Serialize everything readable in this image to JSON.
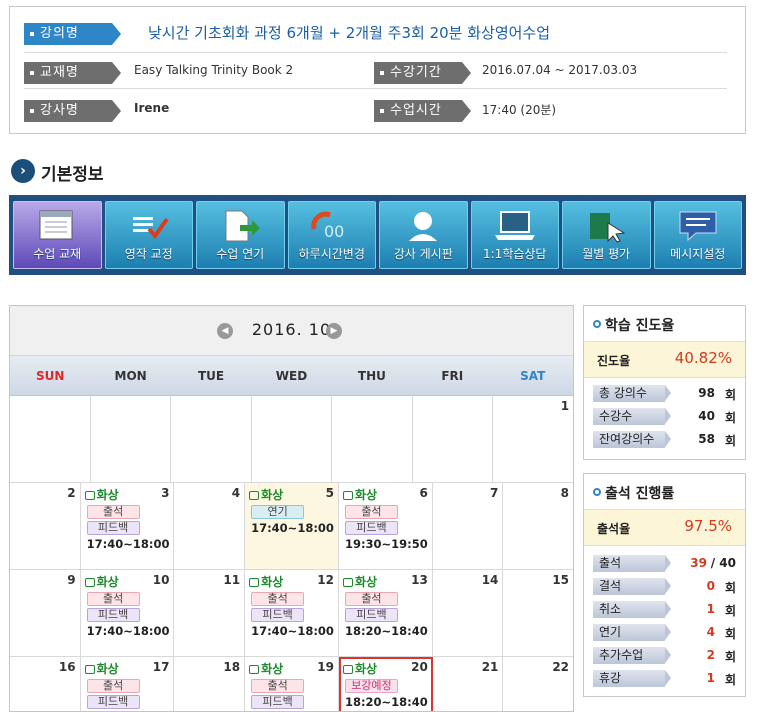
{
  "course": {
    "name_label": "강의명",
    "name": "낮시간 기초회화 과정 6개월 + 2개월 주3회 20분 화상영어수업",
    "book_label": "교재명",
    "book": "Easy Talking Trinity Book 2",
    "period_label": "수강기간",
    "period": "2016.07.04 ~ 2017.03.03",
    "teacher_label": "강사명",
    "teacher": "Irene",
    "time_label": "수업시간",
    "time": "17:40 (20분)"
  },
  "section": {
    "title": "기본정보"
  },
  "toolbar": [
    {
      "label": "수업 교재",
      "icon": "book-icon"
    },
    {
      "label": "영작 교정",
      "icon": "checkmark-edit-icon"
    },
    {
      "label": "수업 연기",
      "icon": "document-arrow-icon"
    },
    {
      "label": "하루시간변경",
      "icon": "clock-change-icon"
    },
    {
      "label": "강사 게시판",
      "icon": "user-icon"
    },
    {
      "label": "1:1학습상담",
      "icon": "laptop-icon"
    },
    {
      "label": "월별 평가",
      "icon": "chart-cursor-icon"
    },
    {
      "label": "메시지설정",
      "icon": "chat-bubble-icon"
    }
  ],
  "calendar": {
    "month": "2016. 10",
    "days": [
      "SUN",
      "MON",
      "TUE",
      "WED",
      "THU",
      "FRI",
      "SAT"
    ],
    "sun_color": "#e02828",
    "sat_color": "#2f86c6",
    "lesson_label": "화상",
    "attend_label": "출석",
    "feedback_label": "피드백",
    "delay_label": "연기",
    "makeup_label": "보강예정",
    "weeks": [
      [
        {
          "n": ""
        },
        {
          "n": ""
        },
        {
          "n": ""
        },
        {
          "n": ""
        },
        {
          "n": ""
        },
        {
          "n": ""
        },
        {
          "n": "1"
        }
      ],
      [
        {
          "n": "2"
        },
        {
          "n": "3",
          "lesson": true,
          "tags": [
            "att",
            "fb"
          ],
          "time": "17:40~18:00"
        },
        {
          "n": "4"
        },
        {
          "n": "5",
          "lesson": true,
          "today": true,
          "tags": [
            "del"
          ],
          "time": "17:40~18:00"
        },
        {
          "n": "6",
          "lesson": true,
          "tags": [
            "att",
            "fb"
          ],
          "time": "19:30~19:50"
        },
        {
          "n": "7"
        },
        {
          "n": "8"
        }
      ],
      [
        {
          "n": "9"
        },
        {
          "n": "10",
          "lesson": true,
          "tags": [
            "att",
            "fb"
          ],
          "time": "17:40~18:00"
        },
        {
          "n": "11"
        },
        {
          "n": "12",
          "lesson": true,
          "tags": [
            "att",
            "fb"
          ],
          "time": "17:40~18:00"
        },
        {
          "n": "13",
          "lesson": true,
          "tags": [
            "att",
            "fb"
          ],
          "time": "18:20~18:40"
        },
        {
          "n": "14"
        },
        {
          "n": "15"
        }
      ],
      [
        {
          "n": "16"
        },
        {
          "n": "17",
          "lesson": true,
          "tags": [
            "att",
            "fb"
          ],
          "time": "17:40~18:00"
        },
        {
          "n": "18"
        },
        {
          "n": "19",
          "lesson": true,
          "tags": [
            "att",
            "fb"
          ],
          "time": "17:40~18:00"
        },
        {
          "n": "20",
          "lesson": true,
          "selected": true,
          "tags": [
            "mk"
          ],
          "time": "18:20~18:40"
        },
        {
          "n": "21"
        },
        {
          "n": "22"
        }
      ]
    ]
  },
  "progress": {
    "title": "학습 진도율",
    "rate_label": "진도율",
    "rate": "40.82%",
    "rows": [
      {
        "label": "총 강의수",
        "value": "98",
        "unit": "회"
      },
      {
        "label": "수강수",
        "value": "40",
        "unit": "회"
      },
      {
        "label": "잔여강의수",
        "value": "58",
        "unit": "회"
      }
    ]
  },
  "attendance": {
    "title": "출석 진행률",
    "rate_label": "출석율",
    "rate": "97.5%",
    "rows": [
      {
        "label": "출석",
        "value": "39",
        "unit": "/ 40"
      },
      {
        "label": "결석",
        "value": "0",
        "unit": "회"
      },
      {
        "label": "취소",
        "value": "1",
        "unit": "회"
      },
      {
        "label": "연기",
        "value": "4",
        "unit": "회"
      },
      {
        "label": "추가수업",
        "value": "2",
        "unit": "회"
      },
      {
        "label": "휴강",
        "value": "1",
        "unit": "회"
      }
    ]
  }
}
